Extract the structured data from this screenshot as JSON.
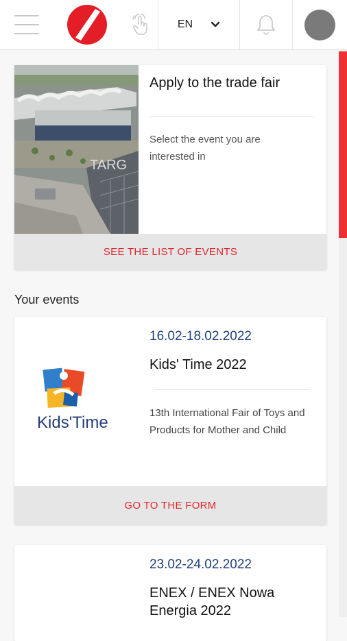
{
  "header": {
    "language": "EN",
    "menu_icon": "hamburger-menu-icon",
    "logo_icon": "brand-logo-icon",
    "touch_icon": "touch-gesture-icon",
    "chevron_icon": "chevron-down-icon",
    "bell_icon": "bell-icon",
    "avatar_icon": "user-avatar"
  },
  "apply": {
    "title": "Apply to the trade fair",
    "description": "Select the event you are interested in",
    "action": "SEE THE LIST OF EVENTS",
    "photo_sign": "TARG"
  },
  "section": {
    "your_events": "Your events"
  },
  "events": [
    {
      "date": "16.02-18.02.2022",
      "name": "Kids' Time 2022",
      "description": "13th International Fair of Toys and Products for Mother and Child",
      "logo_text": "Kids'Time",
      "action": "GO TO THE FORM"
    },
    {
      "date": "23.02-24.02.2022",
      "name": "ENEX / ENEX Nowa Energia 2022"
    }
  ],
  "colors": {
    "accent_red": "#e0242d",
    "date_blue": "#1e3f7c",
    "scrollbar": "#ee2f34",
    "footer_bg": "#e6e6e6"
  }
}
